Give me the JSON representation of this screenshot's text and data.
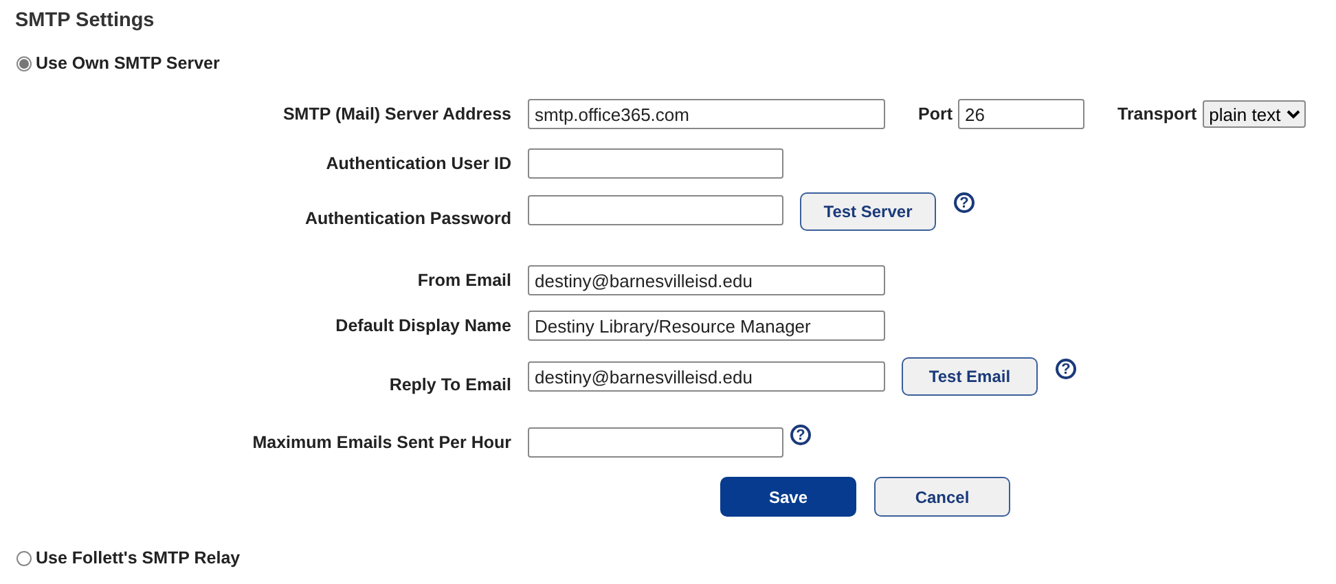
{
  "title": "SMTP Settings",
  "options": [
    {
      "label": "Use Own SMTP Server",
      "selected": true
    },
    {
      "label": "Use Follett's SMTP Relay",
      "selected": false
    }
  ],
  "fields": [
    {
      "label": "SMTP (Mail) Server Address",
      "value": "smtp.office365.com",
      "port": {
        "label": "Port",
        "value": "26"
      },
      "transport": {
        "label": "Transport",
        "value": "plain text"
      }
    },
    {
      "label": "Authentication User ID"
    },
    {
      "label": "Authentication Password",
      "button": "Test Server",
      "help": "?"
    },
    {
      "label": "From Email",
      "value": "destiny@barnesvilleisd.edu"
    },
    {
      "label": "Default Display Name",
      "value": "Destiny Library/Resource Manager"
    },
    {
      "label": "Reply To Email",
      "value": "destiny@barnesvilleisd.edu",
      "button": "Test Email",
      "help": "?"
    },
    {
      "label": "Maximum Emails Sent Per Hour",
      "help": "?"
    }
  ],
  "actions": [
    {
      "label": "Save",
      "kind": "primary"
    },
    {
      "label": "Cancel",
      "kind": "secondary"
    }
  ]
}
